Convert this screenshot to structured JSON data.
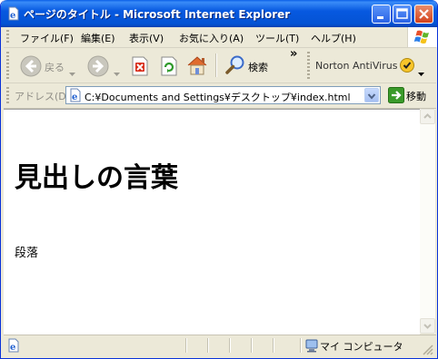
{
  "window": {
    "title": "ページのタイトル - Microsoft Internet Explorer"
  },
  "menubar": {
    "items": [
      "ファイル(F)",
      "編集(E)",
      "表示(V)",
      "お気に入り(A)",
      "ツール(T)",
      "ヘルプ(H)"
    ]
  },
  "toolbar": {
    "back_label": "戻る",
    "search_label": "検索",
    "norton_label": "Norton AntiVirus",
    "overflow_label": "»"
  },
  "addressbar": {
    "label": "アドレス(D)",
    "url": "C:¥Documents and Settings¥デスクトップ¥index.html",
    "go_label": "移動"
  },
  "page": {
    "heading": "見出しの言葉",
    "paragraph": "段落"
  },
  "statusbar": {
    "zone": "マイ コンピュータ"
  },
  "colors": {
    "titlebar": "#0453d4",
    "chrome": "#ece9d8",
    "close_button": "#d4411a",
    "go_arrow": "#3a9a2a"
  }
}
